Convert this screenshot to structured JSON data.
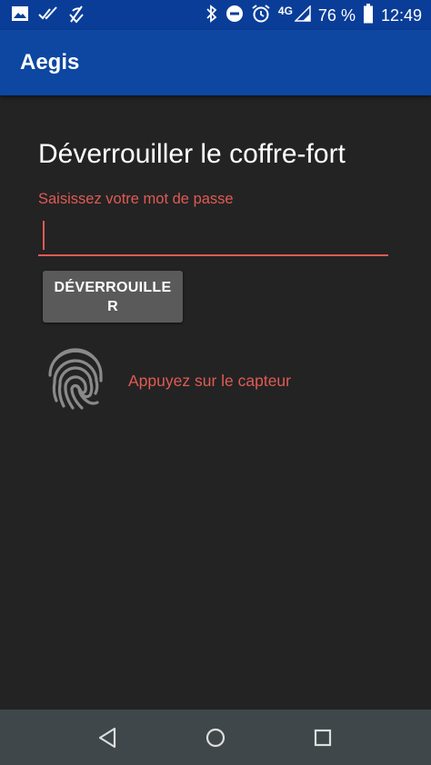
{
  "status_bar": {
    "network_label": "4G",
    "battery_percent": "76 %",
    "time": "12:49",
    "icons": [
      "image-icon",
      "double-check-icon",
      "no-signal-icon",
      "bluetooth-icon",
      "do-not-disturb-icon",
      "alarm-icon",
      "signal-icon",
      "battery-icon"
    ]
  },
  "app_bar": {
    "title": "Aegis",
    "color": "#0d47a1"
  },
  "unlock": {
    "heading": "Déverrouiller le coffre-fort",
    "password_label": "Saisissez votre mot de passe",
    "password_value": "",
    "button_label": "DÉVERROUILLER",
    "fingerprint_hint": "Appuyez sur le capteur",
    "accent_color": "#e05a55"
  },
  "nav_bar": {
    "buttons": [
      "back-icon",
      "home-icon",
      "recents-icon"
    ]
  }
}
